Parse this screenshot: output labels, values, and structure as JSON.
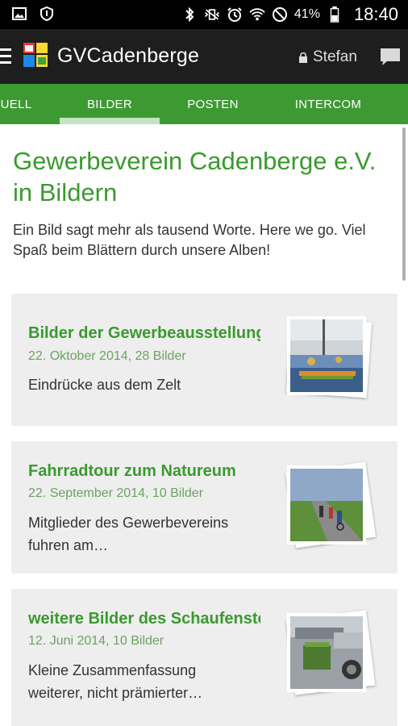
{
  "status_bar": {
    "battery_percent": "41%",
    "time": "18:40"
  },
  "action_bar": {
    "title": "GVCadenberge",
    "user_name": "Stefan"
  },
  "tabs": [
    {
      "label": "UELL",
      "selected": false
    },
    {
      "label": "BILDER",
      "selected": true
    },
    {
      "label": "POSTEN",
      "selected": false
    },
    {
      "label": "INTERCOM",
      "selected": false
    }
  ],
  "page": {
    "heading": "Gewerbeverein Cadenberge e.V. in Bildern",
    "intro": "Ein Bild sagt mehr als tausend Worte. Here we go. Viel Spaß beim Blättern durch unsere Alben!"
  },
  "albums": [
    {
      "title": "Bilder der Gewerbeausstellung",
      "meta": "22. Oktober 2014, 28 Bilder",
      "description": "Eindrücke aus dem Zelt",
      "thumbnail": "tent-event-photo"
    },
    {
      "title": "Fahrradtour zum Natureum",
      "meta": "22. September 2014, 10 Bilder",
      "description": "Mitglieder des Gewerbevereins fuhren am…",
      "thumbnail": "bicycle-tour-photo"
    },
    {
      "title": "weitere Bilder des Schaufensterwettbewerbs",
      "meta": "12. Juni 2014, 10 Bilder",
      "description": "Kleine Zusammenfassung weiterer, nicht prämierter…",
      "thumbnail": "shop-window-photo"
    }
  ],
  "colors": {
    "accent_green": "#3d9a32",
    "action_bar_bg": "#1e1e1e",
    "card_bg": "#eeeeee"
  }
}
